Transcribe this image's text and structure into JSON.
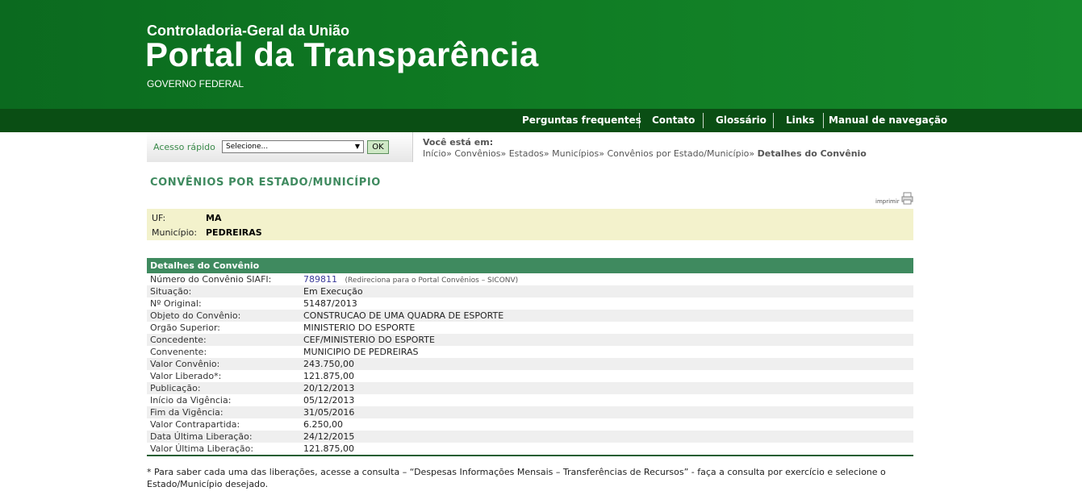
{
  "header": {
    "org_name": "Controladoria-Geral da União",
    "portal_title": "Portal da Transparência",
    "gov_label": "GOVERNO FEDERAL"
  },
  "nav": {
    "items": [
      {
        "label": "Perguntas frequentes"
      },
      {
        "label": "Contato"
      },
      {
        "label": "Glossário"
      },
      {
        "label": "Links"
      },
      {
        "label": "Manual de navegação"
      }
    ]
  },
  "quick_access": {
    "label": "Acesso rápido",
    "selected": "Selecione...",
    "ok_label": "OK"
  },
  "breadcrumb": {
    "heading": "Você está em:",
    "items": [
      "Início",
      "Convênios",
      "Estados",
      "Municípios",
      "Convênios por Estado/Município"
    ],
    "separator": "»",
    "current": "Detalhes do Convênio"
  },
  "page": {
    "title": "CONVÊNIOS POR ESTADO/MUNICÍPIO",
    "print_label": "imprimir"
  },
  "location": {
    "uf_label": "UF:",
    "uf_value": "MA",
    "municipio_label": "Município:",
    "municipio_value": "PEDREIRAS"
  },
  "details": {
    "header": "Detalhes do Convênio",
    "siafi_label": "Número do Convênio SIAFI:",
    "siafi_value": "789811",
    "siafi_note": "(Redireciona para o Portal Convênios – SICONV)",
    "rows": [
      {
        "label": "Situação:",
        "value": "Em Execução"
      },
      {
        "label": "Nº Original:",
        "value": "51487/2013"
      },
      {
        "label": "Objeto do Convênio:",
        "value": "CONSTRUCAO DE UMA QUADRA DE ESPORTE"
      },
      {
        "label": "Orgão Superior:",
        "value": "MINISTERIO DO ESPORTE"
      },
      {
        "label": "Concedente:",
        "value": "CEF/MINISTERIO DO ESPORTE"
      },
      {
        "label": "Convenente:",
        "value": "MUNICIPIO DE PEDREIRAS"
      },
      {
        "label": "Valor Convênio:",
        "value": "243.750,00"
      },
      {
        "label": "Valor Liberado*:",
        "value": "121.875,00"
      },
      {
        "label": "Publicação:",
        "value": "20/12/2013"
      },
      {
        "label": "Início da Vigência:",
        "value": "05/12/2013"
      },
      {
        "label": "Fim da Vigência:",
        "value": "31/05/2016"
      },
      {
        "label": "Valor Contrapartida:",
        "value": "6.250,00"
      },
      {
        "label": "Data Última Liberação:",
        "value": "24/12/2015"
      },
      {
        "label": "Valor Última Liberação:",
        "value": "121.875,00"
      }
    ]
  },
  "footnote": "* Para saber cada uma das liberações, acesse a consulta – “Despesas Informações Mensais – Transferências de Recursos” - faça a consulta por exercício e selecione o Estado/Município desejado.",
  "colors": {
    "header_green": "#0f7a23",
    "nav_green": "#0a4e14",
    "section_green": "#3f8a5f",
    "location_bg": "#f3f2cc"
  }
}
